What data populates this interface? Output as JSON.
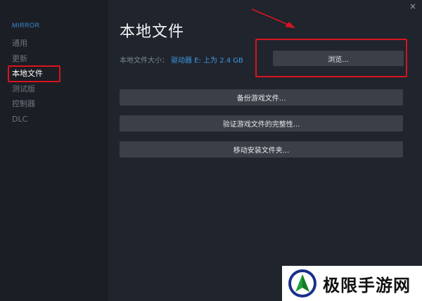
{
  "sidebar": {
    "header": "MIRROR",
    "items": [
      {
        "label": "通用"
      },
      {
        "label": "更新"
      },
      {
        "label": "本地文件"
      },
      {
        "label": "测试版"
      },
      {
        "label": "控制器"
      },
      {
        "label": "DLC"
      }
    ],
    "active_index": 2
  },
  "main": {
    "title": "本地文件",
    "size_label": "本地文件大小：",
    "size_value": "驱动器 E: 上为 2.4 GB",
    "browse_label": "浏览...",
    "buttons": [
      {
        "label": "备份游戏文件..."
      },
      {
        "label": "验证游戏文件的完整性..."
      },
      {
        "label": "移动安装文件夹..."
      }
    ]
  },
  "window": {
    "close_glyph": "×"
  },
  "watermark": {
    "text": "极限手游网"
  },
  "colors": {
    "accent": "#3f8bd6",
    "annotation": "#d8141f",
    "button": "#3b4048",
    "background": "#20242c"
  }
}
